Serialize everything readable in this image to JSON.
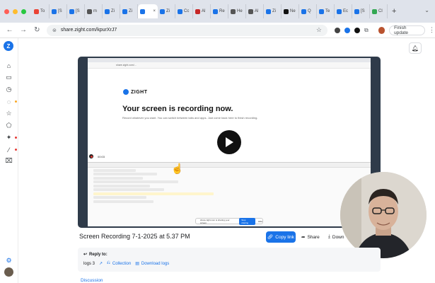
{
  "browser": {
    "tabs": [
      {
        "label": "To",
        "icon": "gmail-icon"
      },
      {
        "label": "[S",
        "icon": "zight-icon"
      },
      {
        "label": "[S",
        "icon": "zight-icon"
      },
      {
        "label": "m",
        "icon": "page-icon"
      },
      {
        "label": "Zi",
        "icon": "zight-icon"
      },
      {
        "label": "Zi",
        "icon": "zight-icon"
      },
      {
        "label": "",
        "icon": "zight-icon",
        "active": true
      },
      {
        "label": "Zi",
        "icon": "zight-icon"
      },
      {
        "label": "Cc",
        "icon": "zight-icon"
      },
      {
        "label": "Al",
        "icon": "person-icon"
      },
      {
        "label": "Re",
        "icon": "zight-icon"
      },
      {
        "label": "He",
        "icon": "page-icon"
      },
      {
        "label": "Al",
        "icon": "page-icon"
      },
      {
        "label": "Zi",
        "icon": "zight-icon"
      },
      {
        "label": "Ne",
        "icon": "github-icon"
      },
      {
        "label": "Q",
        "icon": "zight-icon"
      },
      {
        "label": "Te",
        "icon": "zight-icon"
      },
      {
        "label": "Ec",
        "icon": "zight-icon"
      },
      {
        "label": "[S",
        "icon": "zight-icon"
      },
      {
        "label": "Cl",
        "icon": "chrome-icon"
      }
    ],
    "new_tab": "+",
    "url": "share.zight.com/kpurXrJ7",
    "update_label": "Finish update"
  },
  "video": {
    "inner_url": "share.zight.com/...",
    "logo_text": "ZIGHT",
    "heading": "Your screen is recording now.",
    "subtext": "Record whatever you want. You can switch between tabs and apps. Just come back here to finish recording.",
    "timer": "00:03",
    "toast_text": "share.zight.com is sharing your screen.",
    "toast_stop": "Stop sharing",
    "toast_hide": "Hide"
  },
  "recording": {
    "title": "Screen Recording 7-1-2025 at 5.37 PM",
    "copy_link": "Copy link",
    "share": "Share",
    "download": "Down"
  },
  "reply": {
    "heading": "Reply to:",
    "logs_label": "logs 3",
    "collection": "Collection",
    "download_logs": "Download logs"
  },
  "discussion": "Discussion",
  "colors": {
    "accent": "#1a73e8",
    "tab_bar": "#dfe3eb"
  }
}
